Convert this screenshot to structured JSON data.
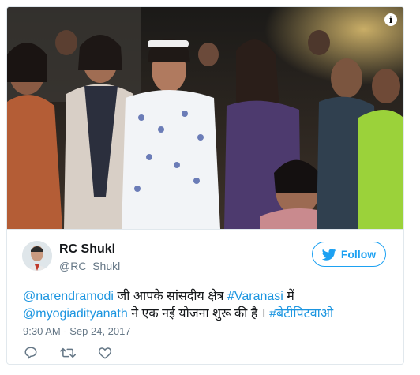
{
  "tweet": {
    "author_name": "RC Shukl",
    "author_handle": "@RC_Shukl",
    "follow_label": "Follow",
    "text_parts": {
      "mention1": "@narendramodi",
      "text1": " जी आपके सांसदीय क्षेत्र ",
      "hashtag1": "#Varanasi",
      "text2": " में",
      "mention2": "@myogiadityanath",
      "text3": " ने एक नई योजना शुरू की है । ",
      "hashtag2": "#बेटीपिटवाओ"
    },
    "timestamp": "9:30 AM - Sep 24, 2017"
  },
  "icons": {
    "info": "info-icon",
    "twitter_bird": "twitter-bird-icon",
    "reply": "reply-icon",
    "retweet": "retweet-icon",
    "like": "heart-icon"
  },
  "colors": {
    "link": "#1b95e0",
    "follow_accent": "#1da1f2",
    "secondary_text": "#657786",
    "border": "#e1e8ed"
  }
}
